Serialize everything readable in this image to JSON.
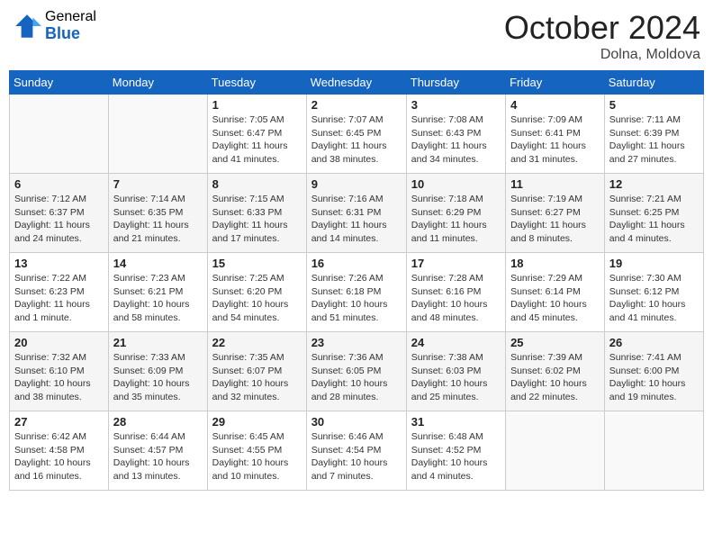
{
  "logo": {
    "general": "General",
    "blue": "Blue"
  },
  "title": {
    "month": "October 2024",
    "location": "Dolna, Moldova"
  },
  "days_of_week": [
    "Sunday",
    "Monday",
    "Tuesday",
    "Wednesday",
    "Thursday",
    "Friday",
    "Saturday"
  ],
  "weeks": [
    [
      null,
      null,
      {
        "day": "1",
        "sunrise": "Sunrise: 7:05 AM",
        "sunset": "Sunset: 6:47 PM",
        "daylight": "Daylight: 11 hours and 41 minutes."
      },
      {
        "day": "2",
        "sunrise": "Sunrise: 7:07 AM",
        "sunset": "Sunset: 6:45 PM",
        "daylight": "Daylight: 11 hours and 38 minutes."
      },
      {
        "day": "3",
        "sunrise": "Sunrise: 7:08 AM",
        "sunset": "Sunset: 6:43 PM",
        "daylight": "Daylight: 11 hours and 34 minutes."
      },
      {
        "day": "4",
        "sunrise": "Sunrise: 7:09 AM",
        "sunset": "Sunset: 6:41 PM",
        "daylight": "Daylight: 11 hours and 31 minutes."
      },
      {
        "day": "5",
        "sunrise": "Sunrise: 7:11 AM",
        "sunset": "Sunset: 6:39 PM",
        "daylight": "Daylight: 11 hours and 27 minutes."
      }
    ],
    [
      {
        "day": "6",
        "sunrise": "Sunrise: 7:12 AM",
        "sunset": "Sunset: 6:37 PM",
        "daylight": "Daylight: 11 hours and 24 minutes."
      },
      {
        "day": "7",
        "sunrise": "Sunrise: 7:14 AM",
        "sunset": "Sunset: 6:35 PM",
        "daylight": "Daylight: 11 hours and 21 minutes."
      },
      {
        "day": "8",
        "sunrise": "Sunrise: 7:15 AM",
        "sunset": "Sunset: 6:33 PM",
        "daylight": "Daylight: 11 hours and 17 minutes."
      },
      {
        "day": "9",
        "sunrise": "Sunrise: 7:16 AM",
        "sunset": "Sunset: 6:31 PM",
        "daylight": "Daylight: 11 hours and 14 minutes."
      },
      {
        "day": "10",
        "sunrise": "Sunrise: 7:18 AM",
        "sunset": "Sunset: 6:29 PM",
        "daylight": "Daylight: 11 hours and 11 minutes."
      },
      {
        "day": "11",
        "sunrise": "Sunrise: 7:19 AM",
        "sunset": "Sunset: 6:27 PM",
        "daylight": "Daylight: 11 hours and 8 minutes."
      },
      {
        "day": "12",
        "sunrise": "Sunrise: 7:21 AM",
        "sunset": "Sunset: 6:25 PM",
        "daylight": "Daylight: 11 hours and 4 minutes."
      }
    ],
    [
      {
        "day": "13",
        "sunrise": "Sunrise: 7:22 AM",
        "sunset": "Sunset: 6:23 PM",
        "daylight": "Daylight: 11 hours and 1 minute."
      },
      {
        "day": "14",
        "sunrise": "Sunrise: 7:23 AM",
        "sunset": "Sunset: 6:21 PM",
        "daylight": "Daylight: 10 hours and 58 minutes."
      },
      {
        "day": "15",
        "sunrise": "Sunrise: 7:25 AM",
        "sunset": "Sunset: 6:20 PM",
        "daylight": "Daylight: 10 hours and 54 minutes."
      },
      {
        "day": "16",
        "sunrise": "Sunrise: 7:26 AM",
        "sunset": "Sunset: 6:18 PM",
        "daylight": "Daylight: 10 hours and 51 minutes."
      },
      {
        "day": "17",
        "sunrise": "Sunrise: 7:28 AM",
        "sunset": "Sunset: 6:16 PM",
        "daylight": "Daylight: 10 hours and 48 minutes."
      },
      {
        "day": "18",
        "sunrise": "Sunrise: 7:29 AM",
        "sunset": "Sunset: 6:14 PM",
        "daylight": "Daylight: 10 hours and 45 minutes."
      },
      {
        "day": "19",
        "sunrise": "Sunrise: 7:30 AM",
        "sunset": "Sunset: 6:12 PM",
        "daylight": "Daylight: 10 hours and 41 minutes."
      }
    ],
    [
      {
        "day": "20",
        "sunrise": "Sunrise: 7:32 AM",
        "sunset": "Sunset: 6:10 PM",
        "daylight": "Daylight: 10 hours and 38 minutes."
      },
      {
        "day": "21",
        "sunrise": "Sunrise: 7:33 AM",
        "sunset": "Sunset: 6:09 PM",
        "daylight": "Daylight: 10 hours and 35 minutes."
      },
      {
        "day": "22",
        "sunrise": "Sunrise: 7:35 AM",
        "sunset": "Sunset: 6:07 PM",
        "daylight": "Daylight: 10 hours and 32 minutes."
      },
      {
        "day": "23",
        "sunrise": "Sunrise: 7:36 AM",
        "sunset": "Sunset: 6:05 PM",
        "daylight": "Daylight: 10 hours and 28 minutes."
      },
      {
        "day": "24",
        "sunrise": "Sunrise: 7:38 AM",
        "sunset": "Sunset: 6:03 PM",
        "daylight": "Daylight: 10 hours and 25 minutes."
      },
      {
        "day": "25",
        "sunrise": "Sunrise: 7:39 AM",
        "sunset": "Sunset: 6:02 PM",
        "daylight": "Daylight: 10 hours and 22 minutes."
      },
      {
        "day": "26",
        "sunrise": "Sunrise: 7:41 AM",
        "sunset": "Sunset: 6:00 PM",
        "daylight": "Daylight: 10 hours and 19 minutes."
      }
    ],
    [
      {
        "day": "27",
        "sunrise": "Sunrise: 6:42 AM",
        "sunset": "Sunset: 4:58 PM",
        "daylight": "Daylight: 10 hours and 16 minutes."
      },
      {
        "day": "28",
        "sunrise": "Sunrise: 6:44 AM",
        "sunset": "Sunset: 4:57 PM",
        "daylight": "Daylight: 10 hours and 13 minutes."
      },
      {
        "day": "29",
        "sunrise": "Sunrise: 6:45 AM",
        "sunset": "Sunset: 4:55 PM",
        "daylight": "Daylight: 10 hours and 10 minutes."
      },
      {
        "day": "30",
        "sunrise": "Sunrise: 6:46 AM",
        "sunset": "Sunset: 4:54 PM",
        "daylight": "Daylight: 10 hours and 7 minutes."
      },
      {
        "day": "31",
        "sunrise": "Sunrise: 6:48 AM",
        "sunset": "Sunset: 4:52 PM",
        "daylight": "Daylight: 10 hours and 4 minutes."
      },
      null,
      null
    ]
  ]
}
